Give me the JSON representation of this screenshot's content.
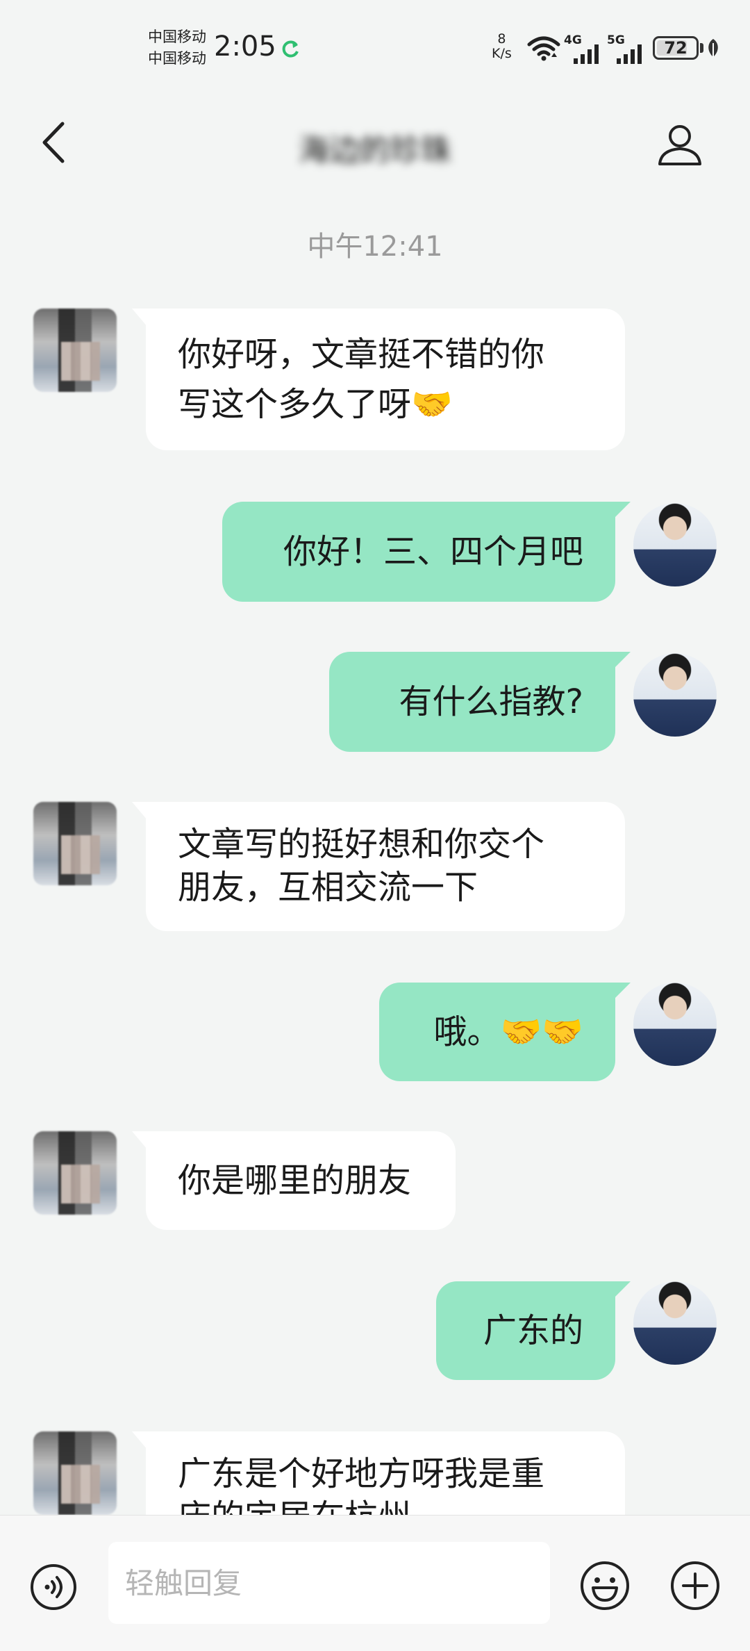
{
  "status_bar": {
    "carrier_1": "中国移动",
    "carrier_2": "中国移动",
    "time": "2:05",
    "net_speed_value": "8",
    "net_speed_unit": "K/s",
    "signal_1_label": "4G",
    "signal_2_label": "5G",
    "battery_level": "72"
  },
  "header": {
    "title": "海边的珍珠"
  },
  "chat": {
    "timestamp": "中午12:41",
    "messages": [
      {
        "side": "in",
        "lines": [
          "你好呀，文章挺不错的你",
          "写这个多久了呀🤝"
        ]
      },
      {
        "side": "out",
        "lines": [
          "你好！三、四个月吧"
        ]
      },
      {
        "side": "out",
        "lines": [
          "有什么指教?"
        ]
      },
      {
        "side": "in",
        "lines": [
          "文章写的挺好想和你交个",
          "朋友，互相交流一下"
        ]
      },
      {
        "side": "out",
        "lines": [
          "哦。🤝🤝"
        ]
      },
      {
        "side": "in",
        "lines": [
          "你是哪里的朋友"
        ]
      },
      {
        "side": "out",
        "lines": [
          "广东的"
        ]
      },
      {
        "side": "in",
        "lines": [
          "广东是个好地方呀我是重",
          "庆的定居在杭州"
        ]
      }
    ]
  },
  "input_bar": {
    "placeholder": "轻触回复"
  }
}
